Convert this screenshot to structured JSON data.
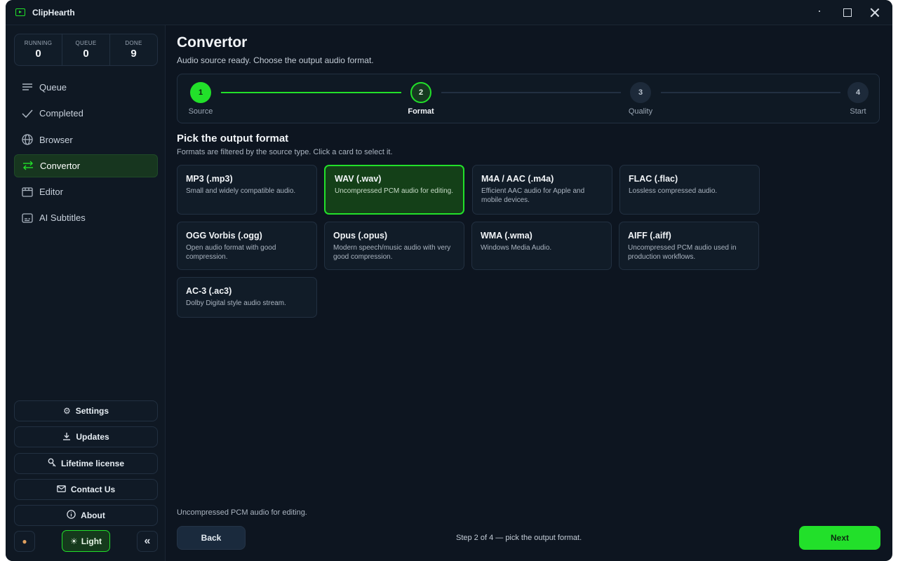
{
  "app": {
    "title": "ClipHearth",
    "accent": "#22e02a"
  },
  "stats": [
    {
      "label": "RUNNING",
      "value": "0"
    },
    {
      "label": "QUEUE",
      "value": "0"
    },
    {
      "label": "DONE",
      "value": "9"
    }
  ],
  "nav": [
    {
      "label": "Queue",
      "icon": "list-icon"
    },
    {
      "label": "Completed",
      "icon": "check-icon"
    },
    {
      "label": "Browser",
      "icon": "globe-icon"
    },
    {
      "label": "Convertor",
      "icon": "swap-arrows-icon",
      "active": true
    },
    {
      "label": "Editor",
      "icon": "film-icon"
    },
    {
      "label": "AI Subtitles",
      "icon": "subtitles-icon"
    }
  ],
  "side_buttons": {
    "settings": "Settings",
    "updates": "Updates",
    "license": "Lifetime license",
    "contact": "Contact Us",
    "about": "About"
  },
  "theme_button": {
    "label": "Light",
    "icon": "sun-icon"
  },
  "page": {
    "title": "Convertor",
    "subtitle": "Audio source ready. Choose the output audio format."
  },
  "steps": [
    {
      "number": "1",
      "label": "Source",
      "state": "done"
    },
    {
      "number": "2",
      "label": "Format",
      "state": "current"
    },
    {
      "number": "3",
      "label": "Quality",
      "state": "todo"
    },
    {
      "number": "4",
      "label": "Start",
      "state": "todo"
    }
  ],
  "section": {
    "title": "Pick the output format",
    "subtitle": "Formats are filtered by the source type. Click a card to select it."
  },
  "formats": [
    {
      "title": "MP3 (.mp3)",
      "desc": "Small and widely compatible audio."
    },
    {
      "title": "WAV (.wav)",
      "desc": "Uncompressed PCM audio for editing.",
      "selected": true
    },
    {
      "title": "M4A / AAC (.m4a)",
      "desc": "Efficient AAC audio for Apple and mobile devices."
    },
    {
      "title": "FLAC (.flac)",
      "desc": "Lossless compressed audio."
    },
    {
      "title": "OGG Vorbis (.ogg)",
      "desc": "Open audio format with good compression."
    },
    {
      "title": "Opus (.opus)",
      "desc": "Modern speech/music audio with very good compression."
    },
    {
      "title": "WMA (.wma)",
      "desc": "Windows Media Audio."
    },
    {
      "title": "AIFF (.aiff)",
      "desc": "Uncompressed PCM audio used in production workflows."
    },
    {
      "title": "AC-3 (.ac3)",
      "desc": "Dolby Digital style audio stream."
    }
  ],
  "footer": {
    "note": "Uncompressed PCM audio for editing.",
    "back": "Back",
    "status": "Step 2 of 4 — pick the output format.",
    "next": "Next"
  }
}
